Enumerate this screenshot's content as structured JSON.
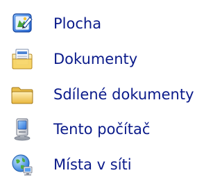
{
  "places": {
    "items": [
      {
        "label": "Plocha",
        "icon": "desktop-icon"
      },
      {
        "label": "Dokumenty",
        "icon": "documents-icon"
      },
      {
        "label": "Sdílené dokumenty",
        "icon": "shared-documents-folder-icon"
      },
      {
        "label": "Tento počítač",
        "icon": "my-computer-icon"
      },
      {
        "label": "Místa v síti",
        "icon": "network-places-icon"
      }
    ]
  },
  "colors": {
    "link_text": "#0a1a8a",
    "background": "#ffffff"
  }
}
